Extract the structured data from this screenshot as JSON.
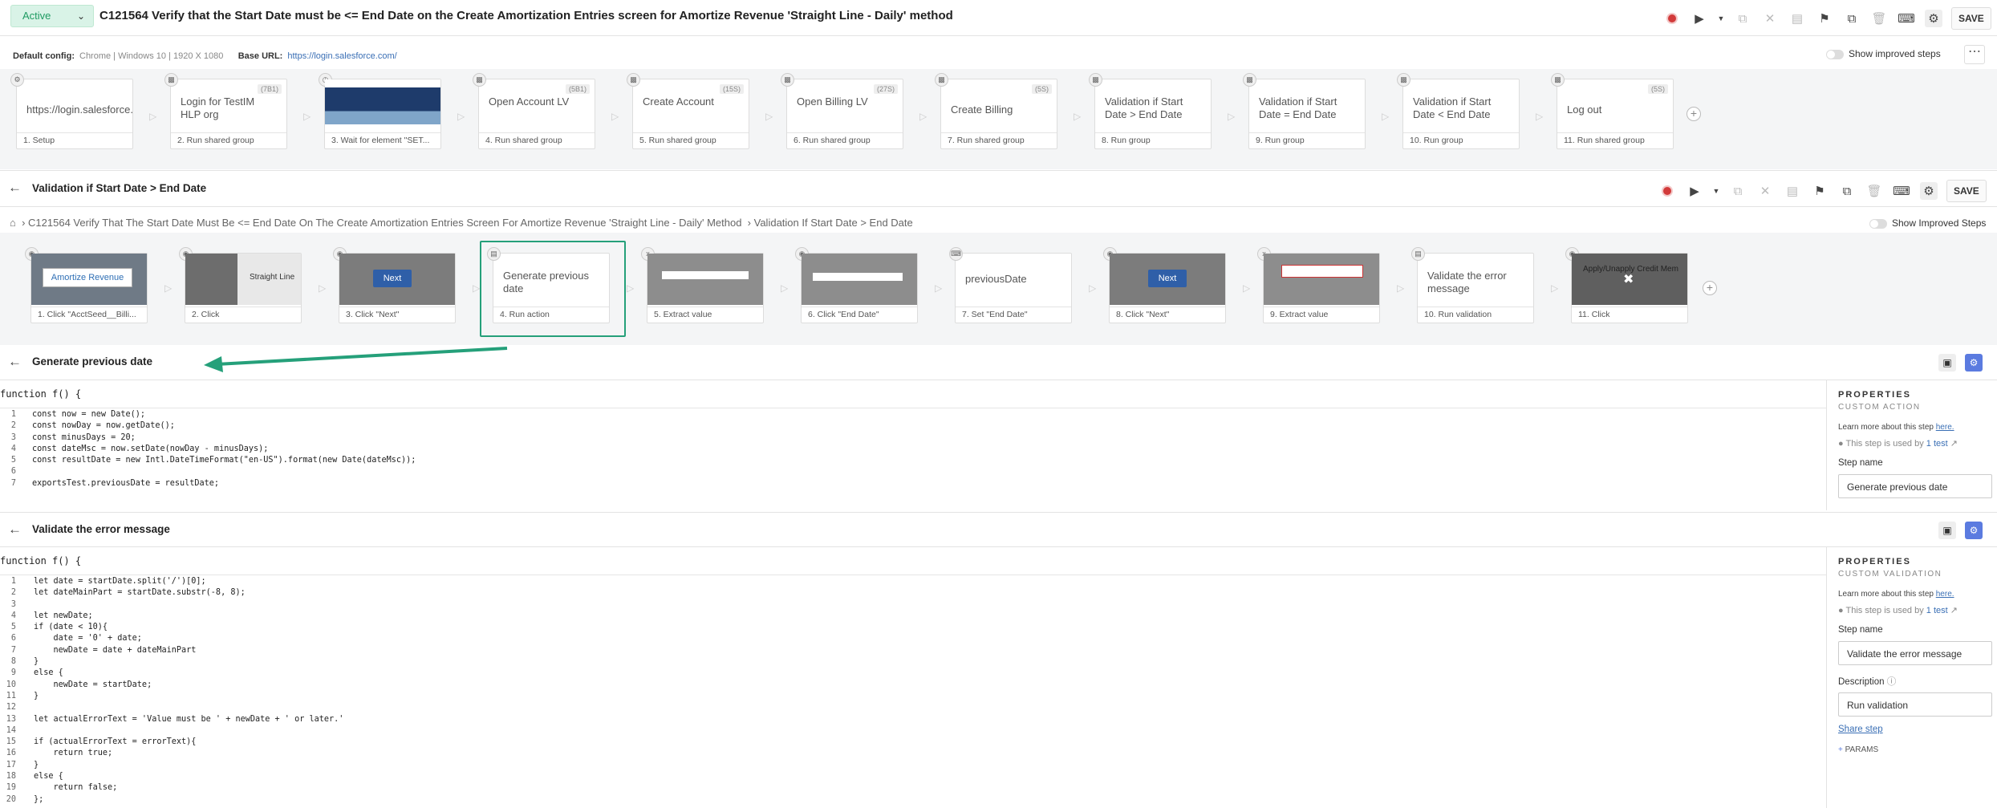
{
  "header": {
    "status": "Active",
    "title": "C121564 Verify that the Start Date must be <= End Date on the Create Amortization Entries screen for Amortize Revenue 'Straight Line - Daily' method",
    "save_label": "SAVE"
  },
  "config": {
    "default_label": "Default config:",
    "default_value": "Chrome | Windows 10 | 1920 X 1080",
    "base_label": "Base URL:",
    "base_value": "https://login.salesforce.com/",
    "improved_label": "Show improved steps"
  },
  "top_steps": [
    {
      "text": "https://login.salesforce.",
      "label": "1. Setup",
      "tag": ""
    },
    {
      "text": "Login for TestIM HLP org",
      "label": "2. Run shared group",
      "tag": "(7B1)"
    },
    {
      "text": "",
      "label": "3. Wait for element \"SET...",
      "tag": ""
    },
    {
      "text": "Open Account LV",
      "label": "4. Run shared group",
      "tag": "(5B1)"
    },
    {
      "text": "Create Account",
      "label": "5. Run shared group",
      "tag": "(15S)"
    },
    {
      "text": "Open Billing LV",
      "label": "6. Run shared group",
      "tag": "(27S)"
    },
    {
      "text": "Create Billing",
      "label": "7. Run shared group",
      "tag": "(5S)"
    },
    {
      "text": "Validation if Start Date > End Date",
      "label": "8. Run group",
      "tag": ""
    },
    {
      "text": "Validation if Start Date = End Date",
      "label": "9. Run group",
      "tag": ""
    },
    {
      "text": "Validation if Start Date < End Date",
      "label": "10. Run group",
      "tag": ""
    },
    {
      "text": "Log out",
      "label": "11. Run shared group",
      "tag": "(5S)"
    }
  ],
  "group": {
    "title": "Validation if Start Date > End Date",
    "save_label": "SAVE",
    "crumb_test": "C121564 Verify That The Start Date Must Be <= End Date On The Create Amortization Entries Screen For Amortize Revenue 'Straight Line - Daily' Method",
    "crumb_group": "Validation If Start Date > End Date",
    "improved_label": "Show Improved Steps"
  },
  "group_steps": [
    {
      "text": "Amortize Revenue",
      "label": "1. Click \"AcctSeed__Billi..."
    },
    {
      "text": "Straight Line",
      "label": "2. Click"
    },
    {
      "text": "Next",
      "label": "3. Click \"Next\""
    },
    {
      "text": "Generate previous date",
      "label": "4. Run action"
    },
    {
      "text": "",
      "label": "5. Extract value"
    },
    {
      "text": "",
      "label": "6. Click \"End Date\""
    },
    {
      "text": "previousDate",
      "label": "7. Set \"End Date\""
    },
    {
      "text": "Next",
      "label": "8. Click \"Next\""
    },
    {
      "text": "",
      "label": "9. Extract value"
    },
    {
      "text": "Validate the error message",
      "label": "10. Run validation"
    },
    {
      "text": "Apply/Unapply Credit Mem",
      "label": "11. Click"
    }
  ],
  "editor1": {
    "title": "Generate previous date",
    "fn_header": "function f() {",
    "lines": [
      "const now = new Date();",
      "const nowDay = now.getDate();",
      "const minusDays = 20;",
      "const dateMsc = now.setDate(nowDay - minusDays);",
      "const resultDate = new Intl.DateTimeFormat(\"en-US\").format(new Date(dateMsc));",
      "",
      "exportsTest.previousDate = resultDate;"
    ],
    "props_title": "PROPERTIES",
    "props_sub": "CUSTOM ACTION",
    "learn": "Learn more about this step",
    "learn_link": "here.",
    "used": "This step is used by",
    "used_link": "1 test",
    "step_name_label": "Step name",
    "step_name": "Generate previous date"
  },
  "editor2": {
    "title": "Validate the error message",
    "fn_header": "function f() {",
    "lines": [
      "let date = startDate.split('/')[0];",
      "let dateMainPart = startDate.substr(-8, 8);",
      "",
      "let newDate;",
      "if (date < 10){",
      "    date = '0' + date;",
      "    newDate = date + dateMainPart",
      "}",
      "else {",
      "    newDate = startDate;",
      "}",
      "",
      "let actualErrorText = 'Value must be ' + newDate + ' or later.'",
      "",
      "if (actualErrorText = errorText){",
      "    return true;",
      "}",
      "else {",
      "    return false;",
      "};"
    ],
    "props_title": "PROPERTIES",
    "props_sub": "CUSTOM VALIDATION",
    "learn": "Learn more about this step",
    "learn_link": "here.",
    "used": "This step is used by",
    "used_link": "1 test",
    "step_name_label": "Step name",
    "step_name": "Validate the error message",
    "description_label": "Description",
    "description": "Run validation",
    "share": "Share step",
    "params": "PARAMS"
  },
  "colors": {
    "accent": "#25a07a",
    "active_bg": "#d9f3e7",
    "link": "#3a6fb5"
  }
}
